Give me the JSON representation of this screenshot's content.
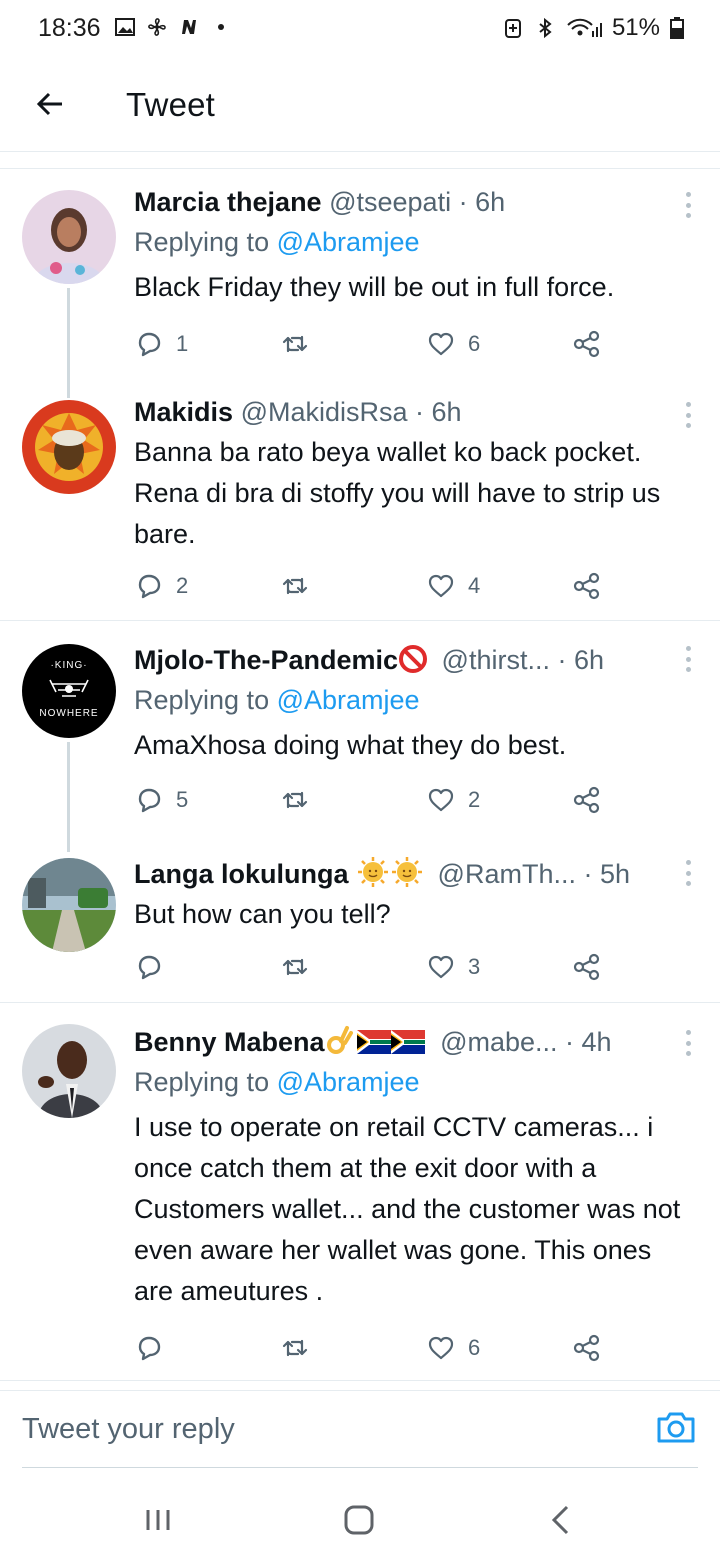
{
  "status_bar": {
    "time": "18:36",
    "battery": "51%"
  },
  "header": {
    "title": "Tweet"
  },
  "tweets": [
    {
      "name": "Marcia thejane",
      "handle": "@tseepati",
      "time": "· 6h",
      "replying_prefix": "Replying to ",
      "replying_to": "@Abramjee",
      "text": "Black Friday they will be out in full force.",
      "replies": "1",
      "retweets": "",
      "likes": "6"
    },
    {
      "name": "Makidis",
      "handle": "@MakidisRsa",
      "time": "· 6h",
      "text": "Banna ba rato beya wallet ko back pocket. Rena di bra di stoffy you will have to strip us bare.",
      "replies": "2",
      "retweets": "",
      "likes": "4"
    },
    {
      "name": "Mjolo-The-Pandemic",
      "handle": "@thirst...",
      "time": "· 6h",
      "replying_prefix": "Replying to ",
      "replying_to": "@Abramjee",
      "text": "AmaXhosa doing what they do best.",
      "replies": "5",
      "retweets": "",
      "likes": "2",
      "avatar_text_top": "·KING·",
      "avatar_text_bottom": "NOWHERE"
    },
    {
      "name": "Langa lokulunga",
      "handle": "@RamTh...",
      "time": "· 5h",
      "text": "But how can you tell?",
      "replies": "",
      "retweets": "",
      "likes": "3"
    },
    {
      "name": "Benny Mabena",
      "handle": "@mabe...",
      "time": "· 4h",
      "replying_prefix": "Replying to ",
      "replying_to": "@Abramjee",
      "text": "I use to operate on retail CCTV cameras... i once catch them at the exit door with a Customers wallet... and the customer was not even aware her wallet was gone. This ones are ameutures .",
      "replies": "",
      "retweets": "",
      "likes": "6"
    }
  ],
  "reply_bar": {
    "placeholder": "Tweet your reply"
  },
  "colors": {
    "accent": "#1d9bf0",
    "secondary_text": "#536471",
    "divider": "#e6ecf0"
  }
}
